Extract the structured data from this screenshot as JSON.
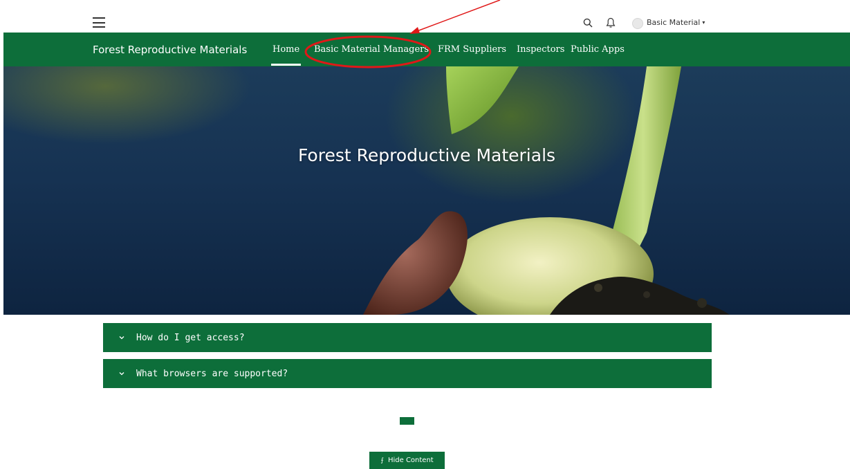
{
  "header": {
    "user_label": "Basic Material",
    "caret": "▾"
  },
  "navbar": {
    "brand": "Forest Reproductive Materials",
    "items": [
      {
        "label": "Home"
      },
      {
        "label": "Basic Material Managers"
      },
      {
        "label": "FRM Suppliers"
      },
      {
        "label": "Inspectors"
      },
      {
        "label": "Public Apps"
      }
    ],
    "active_item": "Home"
  },
  "hero": {
    "title": "Forest Reproductive Materials"
  },
  "accordion": [
    {
      "title": "How do I get access?",
      "chevron": "chevron-down-icon"
    },
    {
      "title": "What browsers are supported?",
      "chevron": "chevron-down-icon"
    }
  ],
  "footer": {
    "hide_button": "Hide Content",
    "hide_icon": "rss-icon"
  },
  "annotation": {
    "highlighted_item": "Basic Material Managers",
    "color": "#e01818"
  },
  "colors": {
    "brand_green": "#0d6e3a"
  }
}
